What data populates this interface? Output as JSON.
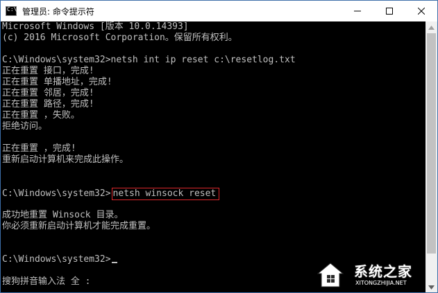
{
  "window": {
    "title": "管理员: 命令提示符",
    "app_icon_glyph": "C:\\_",
    "controls": [
      "minimize",
      "maximize",
      "close"
    ]
  },
  "console": {
    "lines": [
      "Microsoft Windows [版本 10.0.14393]",
      "(c) 2016 Microsoft Corporation。保留所有权利。",
      "",
      "C:\\Windows\\system32>netsh int ip reset c:\\resetlog.txt",
      "正在重置 接口，完成!",
      "正在重置 单播地址，完成!",
      "正在重置 邻居，完成!",
      "正在重置 路径，完成!",
      "正在重置 ，失败。",
      "拒绝访问。",
      "",
      "正在重置 ，完成!",
      "重新启动计算机来完成此操作。",
      "",
      "",
      "C:\\Windows\\system32>",
      "",
      "成功地重置 Winsock 目录。",
      "你必须重新启动计算机才能完成重置。",
      "",
      "",
      "C:\\Windows\\system32>",
      "",
      "搜狗拼音输入法 全 :"
    ],
    "highlighted_command": "netsh winsock reset",
    "highlight_color": "#e0282b",
    "text_color": "#c0c0c0",
    "background_color": "#000000"
  },
  "watermark": {
    "text": "系统之家",
    "url": "XITONGZHIJIA.NET",
    "logo_icon": "house-logo-icon"
  }
}
